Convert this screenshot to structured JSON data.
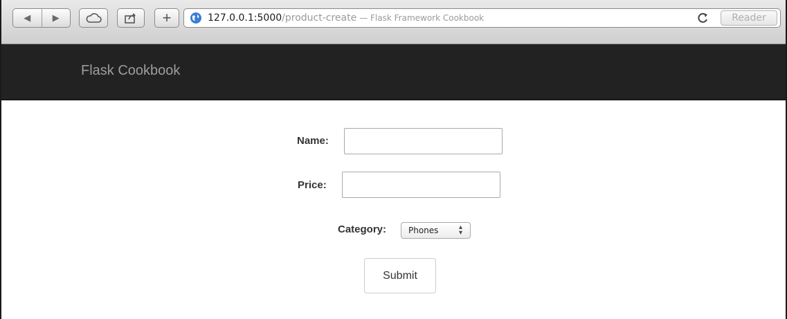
{
  "browser": {
    "url_host": "127.0.0.1:5000",
    "url_path": "/product-create",
    "page_title": "— Flask Framework Cookbook",
    "reader_label": "Reader",
    "add_label": "+"
  },
  "navbar": {
    "brand": "Flask Cookbook",
    "background": "#222222"
  },
  "form": {
    "name_label": "Name:",
    "name_value": "",
    "price_label": "Price:",
    "price_value": "",
    "category_label": "Category:",
    "category_selected": "Phones",
    "submit_label": "Submit"
  }
}
